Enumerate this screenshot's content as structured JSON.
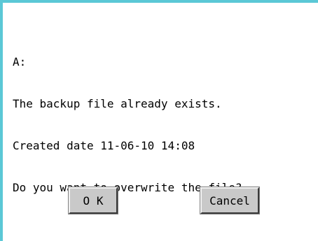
{
  "dialog": {
    "message_lines": [
      "A:",
      "The backup file already exists.",
      "Created date 11-06-10 14:08",
      "Do you want to overwrite the file?"
    ],
    "ok_label": "O K",
    "cancel_label": "Cancel"
  },
  "colors": {
    "frame_border": "#5bc8d6",
    "button_face": "#c9c9c9",
    "background": "#ffffff"
  }
}
